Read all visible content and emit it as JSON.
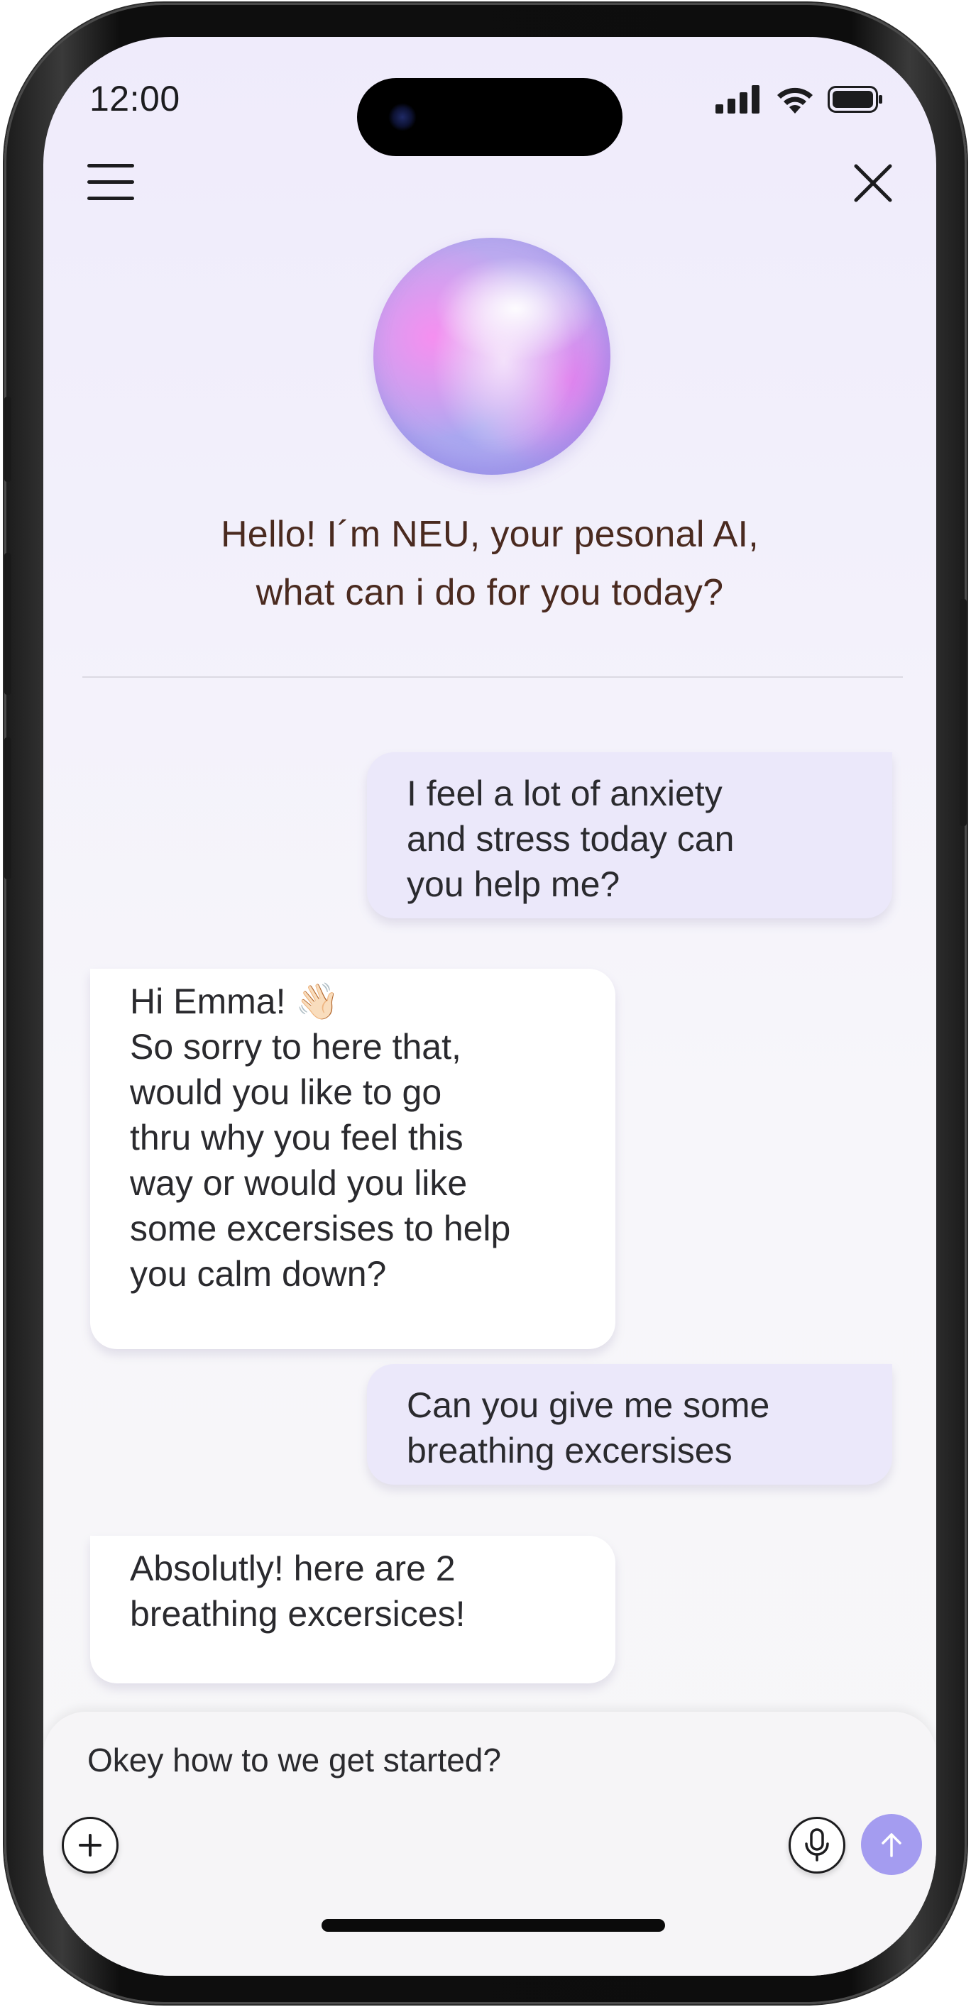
{
  "status_bar": {
    "time": "12:00"
  },
  "header": {
    "menu_icon": "hamburger-menu-icon",
    "close_icon": "close-icon"
  },
  "assistant": {
    "greeting_line1": "Hello! I´m NEU, your pesonal AI,",
    "greeting_line2": "what can i do for you today?"
  },
  "messages": [
    {
      "role": "user",
      "text": "I feel a lot of anxiety\nand stress today can\nyou help me?"
    },
    {
      "role": "ai",
      "greeting": "Hi Emma! ",
      "emoji": "👋🏻",
      "text": "So sorry to here that,\nwould you like to go\nthru why you feel this\nway or would you like\nsome excersises to help\nyou calm down?"
    },
    {
      "role": "user",
      "text": "Can you give me some\nbreathing excersises"
    },
    {
      "role": "ai",
      "text": "Absolutly! here are 2\nbreathing excersices!"
    }
  ],
  "composer": {
    "value": "Okey how to we get started?",
    "add_icon": "plus-icon",
    "mic_icon": "microphone-icon",
    "send_icon": "arrow-up-icon"
  },
  "colors": {
    "user_bubble": "#ebe8fa",
    "ai_bubble": "#ffffff",
    "send_button": "#a49cf0",
    "greeting_text": "#4a2a1f"
  }
}
